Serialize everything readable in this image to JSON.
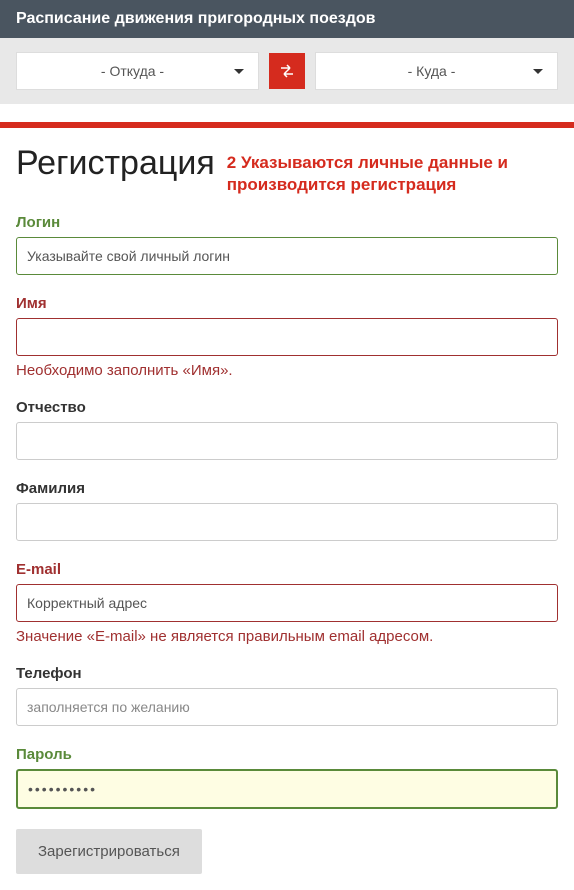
{
  "header": {
    "title": "Расписание движения пригородных поездов"
  },
  "search": {
    "from_placeholder": "- Откуда -",
    "to_placeholder": "- Куда -"
  },
  "page": {
    "title": "Регистрация",
    "annotation": "2 Указываются личные данные и производится регистрация"
  },
  "form": {
    "login": {
      "label": "Логин",
      "value": "Указывайте свой личный логин"
    },
    "name": {
      "label": "Имя",
      "value": "",
      "error": "Необходимо заполнить «Имя»."
    },
    "patronymic": {
      "label": "Отчество",
      "value": ""
    },
    "surname": {
      "label": "Фамилия",
      "value": ""
    },
    "email": {
      "label": "E-mail",
      "value": "Корректный адрес",
      "error": "Значение «E-mail» не является правильным email адресом."
    },
    "phone": {
      "label": "Телефон",
      "placeholder": "заполняется по желанию",
      "value": ""
    },
    "password": {
      "label": "Пароль",
      "value": "••••••••••"
    },
    "submit": "Зарегистрироваться"
  }
}
